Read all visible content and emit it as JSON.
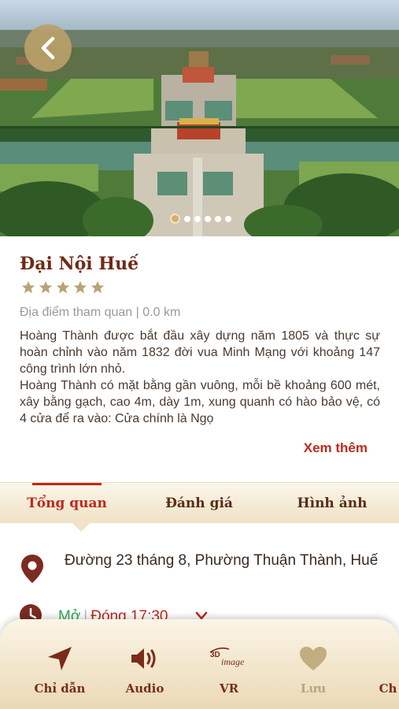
{
  "place": {
    "name": "Đại Nội Huế",
    "rating": 5,
    "category": "Địa điểm tham quan",
    "distance": "0.0 km",
    "description": [
      "Hoàng Thành được bắt đầu xây dựng năm 1805 và thực sự hoàn chỉnh vào năm 1832 đời vua Minh Mạng với khoảng 147 công trình lớn nhỏ.",
      "Hoàng Thành có mặt bằng gần vuông, mỗi bề khoảng 600 mét, xây bằng gạch, cao 4m, dày 1m, xung quanh có hào bảo vệ, có 4 cửa để ra vào: Cửa chính là Ngọ"
    ],
    "more_label": "Xem thêm"
  },
  "gallery": {
    "total": 6,
    "active": 1
  },
  "tabs": [
    {
      "label": "Tổng quan",
      "active": true
    },
    {
      "label": "Đánh giá",
      "active": false
    },
    {
      "label": "Hình ảnh",
      "active": false
    }
  ],
  "details": {
    "address": "Đường 23 tháng 8, Phường Thuận Thành, Huế",
    "status_open": "Mở",
    "closing": "Đóng  17:30"
  },
  "bottom_bar": [
    {
      "label": "Chỉ dẫn",
      "icon": "navigation-arrow-icon"
    },
    {
      "label": "Audio",
      "icon": "speaker-icon"
    },
    {
      "label": "VR",
      "icon": "3d-image-icon"
    },
    {
      "label": "Lưu",
      "icon": "heart-icon"
    },
    {
      "label": "Ch",
      "icon": "share-icon"
    }
  ],
  "colors": {
    "accent": "#c0281c",
    "title": "#6e2a14",
    "gold": "#baa069",
    "open": "#2fa84f"
  }
}
